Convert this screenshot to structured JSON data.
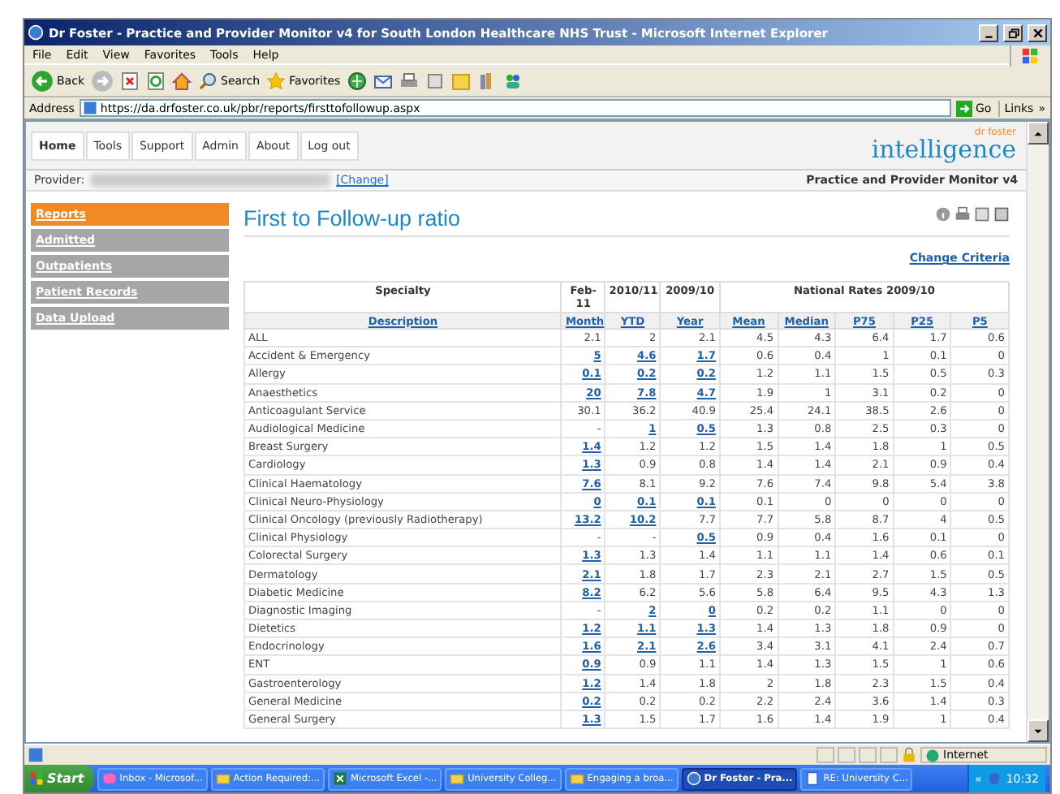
{
  "window": {
    "title": "Dr Foster - Practice and Provider Monitor v4 for South London Healthcare NHS Trust - Microsoft Internet Explorer"
  },
  "menu": [
    "File",
    "Edit",
    "View",
    "Favorites",
    "Tools",
    "Help"
  ],
  "toolbar": [
    {
      "kind": "back",
      "label": "Back"
    },
    {
      "kind": "forward"
    },
    {
      "kind": "stop"
    },
    {
      "kind": "refresh"
    },
    {
      "kind": "home"
    },
    {
      "kind": "search",
      "label": "Search"
    },
    {
      "kind": "favorites",
      "label": "Favorites"
    },
    {
      "kind": "media"
    },
    {
      "kind": "mail"
    },
    {
      "kind": "print"
    },
    {
      "kind": "edit"
    },
    {
      "kind": "folder"
    },
    {
      "kind": "research"
    },
    {
      "kind": "messenger"
    }
  ],
  "address": {
    "label": "Address",
    "url": "https://da.drfoster.co.uk/pbr/reports/firsttofollowup.aspx",
    "go": "Go",
    "links": "Links",
    "more": "»"
  },
  "site": {
    "nav": [
      {
        "label": "Home",
        "selected": true
      },
      {
        "label": "Tools",
        "selected": false
      },
      {
        "label": "Support",
        "selected": false
      },
      {
        "label": "Admin",
        "selected": false
      },
      {
        "label": "About",
        "selected": false
      },
      {
        "label": "Log out",
        "selected": false
      }
    ],
    "logo_small": "dr foster",
    "logo": "intelligence",
    "provider_label": "Provider:",
    "change": "[Change]",
    "product": "Practice and Provider Monitor v4"
  },
  "sidebar": [
    {
      "label": "Reports",
      "selected": true
    },
    {
      "label": "Admitted",
      "selected": false
    },
    {
      "label": "Outpatients",
      "selected": false
    },
    {
      "label": "Patient Records",
      "selected": false
    },
    {
      "label": "Data Upload",
      "selected": false
    }
  ],
  "page_title": "First to Follow-up ratio",
  "change_criteria": "Change Criteria",
  "table": {
    "header": {
      "specialty": "Specialty",
      "month": "Feb-11",
      "ytd": "2010/11",
      "year": "2009/10",
      "national": "National Rates 2009/10"
    },
    "columns": [
      "Description",
      "Month",
      "YTD",
      "Year",
      "Mean",
      "Median",
      "P75",
      "P25",
      "P5"
    ],
    "rows": [
      {
        "name": "ALL",
        "values": [
          "2.1",
          "2",
          "2.1",
          "4.5",
          "4.3",
          "6.4",
          "1.7",
          "0.6"
        ],
        "links": [
          false,
          false,
          false
        ]
      },
      {
        "name": "Accident & Emergency",
        "values": [
          "5",
          "4.6",
          "1.7",
          "0.6",
          "0.4",
          "1",
          "0.1",
          "0"
        ],
        "links": [
          true,
          true,
          true
        ]
      },
      {
        "name": "Allergy",
        "values": [
          "0.1",
          "0.2",
          "0.2",
          "1.2",
          "1.1",
          "1.5",
          "0.5",
          "0.3"
        ],
        "links": [
          true,
          true,
          true
        ]
      },
      {
        "name": "Anaesthetics",
        "values": [
          "20",
          "7.8",
          "4.7",
          "1.9",
          "1",
          "3.1",
          "0.2",
          "0"
        ],
        "links": [
          true,
          true,
          true
        ]
      },
      {
        "name": "Anticoagulant Service",
        "values": [
          "30.1",
          "36.2",
          "40.9",
          "25.4",
          "24.1",
          "38.5",
          "2.6",
          "0"
        ],
        "links": [
          false,
          false,
          false
        ]
      },
      {
        "name": "Audiological Medicine",
        "values": [
          "-",
          "1",
          "0.5",
          "1.3",
          "0.8",
          "2.5",
          "0.3",
          "0"
        ],
        "links": [
          false,
          true,
          true
        ]
      },
      {
        "name": "Breast Surgery",
        "values": [
          "1.4",
          "1.2",
          "1.2",
          "1.5",
          "1.4",
          "1.8",
          "1",
          "0.5"
        ],
        "links": [
          true,
          false,
          false
        ]
      },
      {
        "name": "Cardiology",
        "values": [
          "1.3",
          "0.9",
          "0.8",
          "1.4",
          "1.4",
          "2.1",
          "0.9",
          "0.4"
        ],
        "links": [
          true,
          false,
          false
        ]
      },
      {
        "name": "Clinical Haematology",
        "values": [
          "7.6",
          "8.1",
          "9.2",
          "7.6",
          "7.4",
          "9.8",
          "5.4",
          "3.8"
        ],
        "links": [
          true,
          false,
          false
        ]
      },
      {
        "name": "Clinical Neuro-Physiology",
        "values": [
          "0",
          "0.1",
          "0.1",
          "0.1",
          "0",
          "0",
          "0",
          "0"
        ],
        "links": [
          true,
          true,
          true
        ]
      },
      {
        "name": "Clinical Oncology (previously Radiotherapy)",
        "values": [
          "13.2",
          "10.2",
          "7.7",
          "7.7",
          "5.8",
          "8.7",
          "4",
          "0.5"
        ],
        "links": [
          true,
          true,
          false
        ]
      },
      {
        "name": "Clinical Physiology",
        "values": [
          "-",
          "-",
          "0.5",
          "0.9",
          "0.4",
          "1.6",
          "0.1",
          "0"
        ],
        "links": [
          false,
          false,
          true
        ]
      },
      {
        "name": "Colorectal Surgery",
        "values": [
          "1.3",
          "1.3",
          "1.4",
          "1.1",
          "1.1",
          "1.4",
          "0.6",
          "0.1"
        ],
        "links": [
          true,
          false,
          false
        ]
      },
      {
        "name": "Dermatology",
        "values": [
          "2.1",
          "1.8",
          "1.7",
          "2.3",
          "2.1",
          "2.7",
          "1.5",
          "0.5"
        ],
        "links": [
          true,
          false,
          false
        ]
      },
      {
        "name": "Diabetic Medicine",
        "values": [
          "8.2",
          "6.2",
          "5.6",
          "5.8",
          "6.4",
          "9.5",
          "4.3",
          "1.3"
        ],
        "links": [
          true,
          false,
          false
        ]
      },
      {
        "name": "Diagnostic Imaging",
        "values": [
          "-",
          "2",
          "0",
          "0.2",
          "0.2",
          "1.1",
          "0",
          "0"
        ],
        "links": [
          false,
          true,
          true
        ]
      },
      {
        "name": "Dietetics",
        "values": [
          "1.2",
          "1.1",
          "1.3",
          "1.4",
          "1.3",
          "1.8",
          "0.9",
          "0"
        ],
        "links": [
          true,
          true,
          true
        ]
      },
      {
        "name": "Endocrinology",
        "values": [
          "1.6",
          "2.1",
          "2.6",
          "3.4",
          "3.1",
          "4.1",
          "2.4",
          "0.7"
        ],
        "links": [
          true,
          true,
          true
        ]
      },
      {
        "name": "ENT",
        "values": [
          "0.9",
          "0.9",
          "1.1",
          "1.4",
          "1.3",
          "1.5",
          "1",
          "0.6"
        ],
        "links": [
          true,
          false,
          false
        ]
      },
      {
        "name": "Gastroenterology",
        "values": [
          "1.2",
          "1.4",
          "1.8",
          "2",
          "1.8",
          "2.3",
          "1.5",
          "0.4"
        ],
        "links": [
          true,
          false,
          false
        ]
      },
      {
        "name": "General Medicine",
        "values": [
          "0.2",
          "0.2",
          "0.2",
          "2.2",
          "2.4",
          "3.6",
          "1.4",
          "0.3"
        ],
        "links": [
          true,
          false,
          false
        ]
      },
      {
        "name": "General Surgery",
        "values": [
          "1.3",
          "1.5",
          "1.7",
          "1.6",
          "1.4",
          "1.9",
          "1",
          "0.4"
        ],
        "links": [
          true,
          false,
          false
        ]
      }
    ]
  },
  "status": {
    "zone": "Internet"
  },
  "taskbar": {
    "start": "Start",
    "items": [
      {
        "kind": "mail",
        "label": "Inbox - Microsof...",
        "selected": false
      },
      {
        "kind": "folder",
        "label": "Action Required:...",
        "selected": false
      },
      {
        "kind": "excel",
        "label": "Microsoft Excel -...",
        "selected": false
      },
      {
        "kind": "folder",
        "label": "University Colleg...",
        "selected": false
      },
      {
        "kind": "folder",
        "label": "Engaging a broa...",
        "selected": false
      },
      {
        "kind": "ie",
        "label": "Dr Foster - Pra...",
        "selected": true
      },
      {
        "kind": "doc",
        "label": "RE: University C...",
        "selected": false
      }
    ],
    "more": "«",
    "clock": "10:32"
  }
}
